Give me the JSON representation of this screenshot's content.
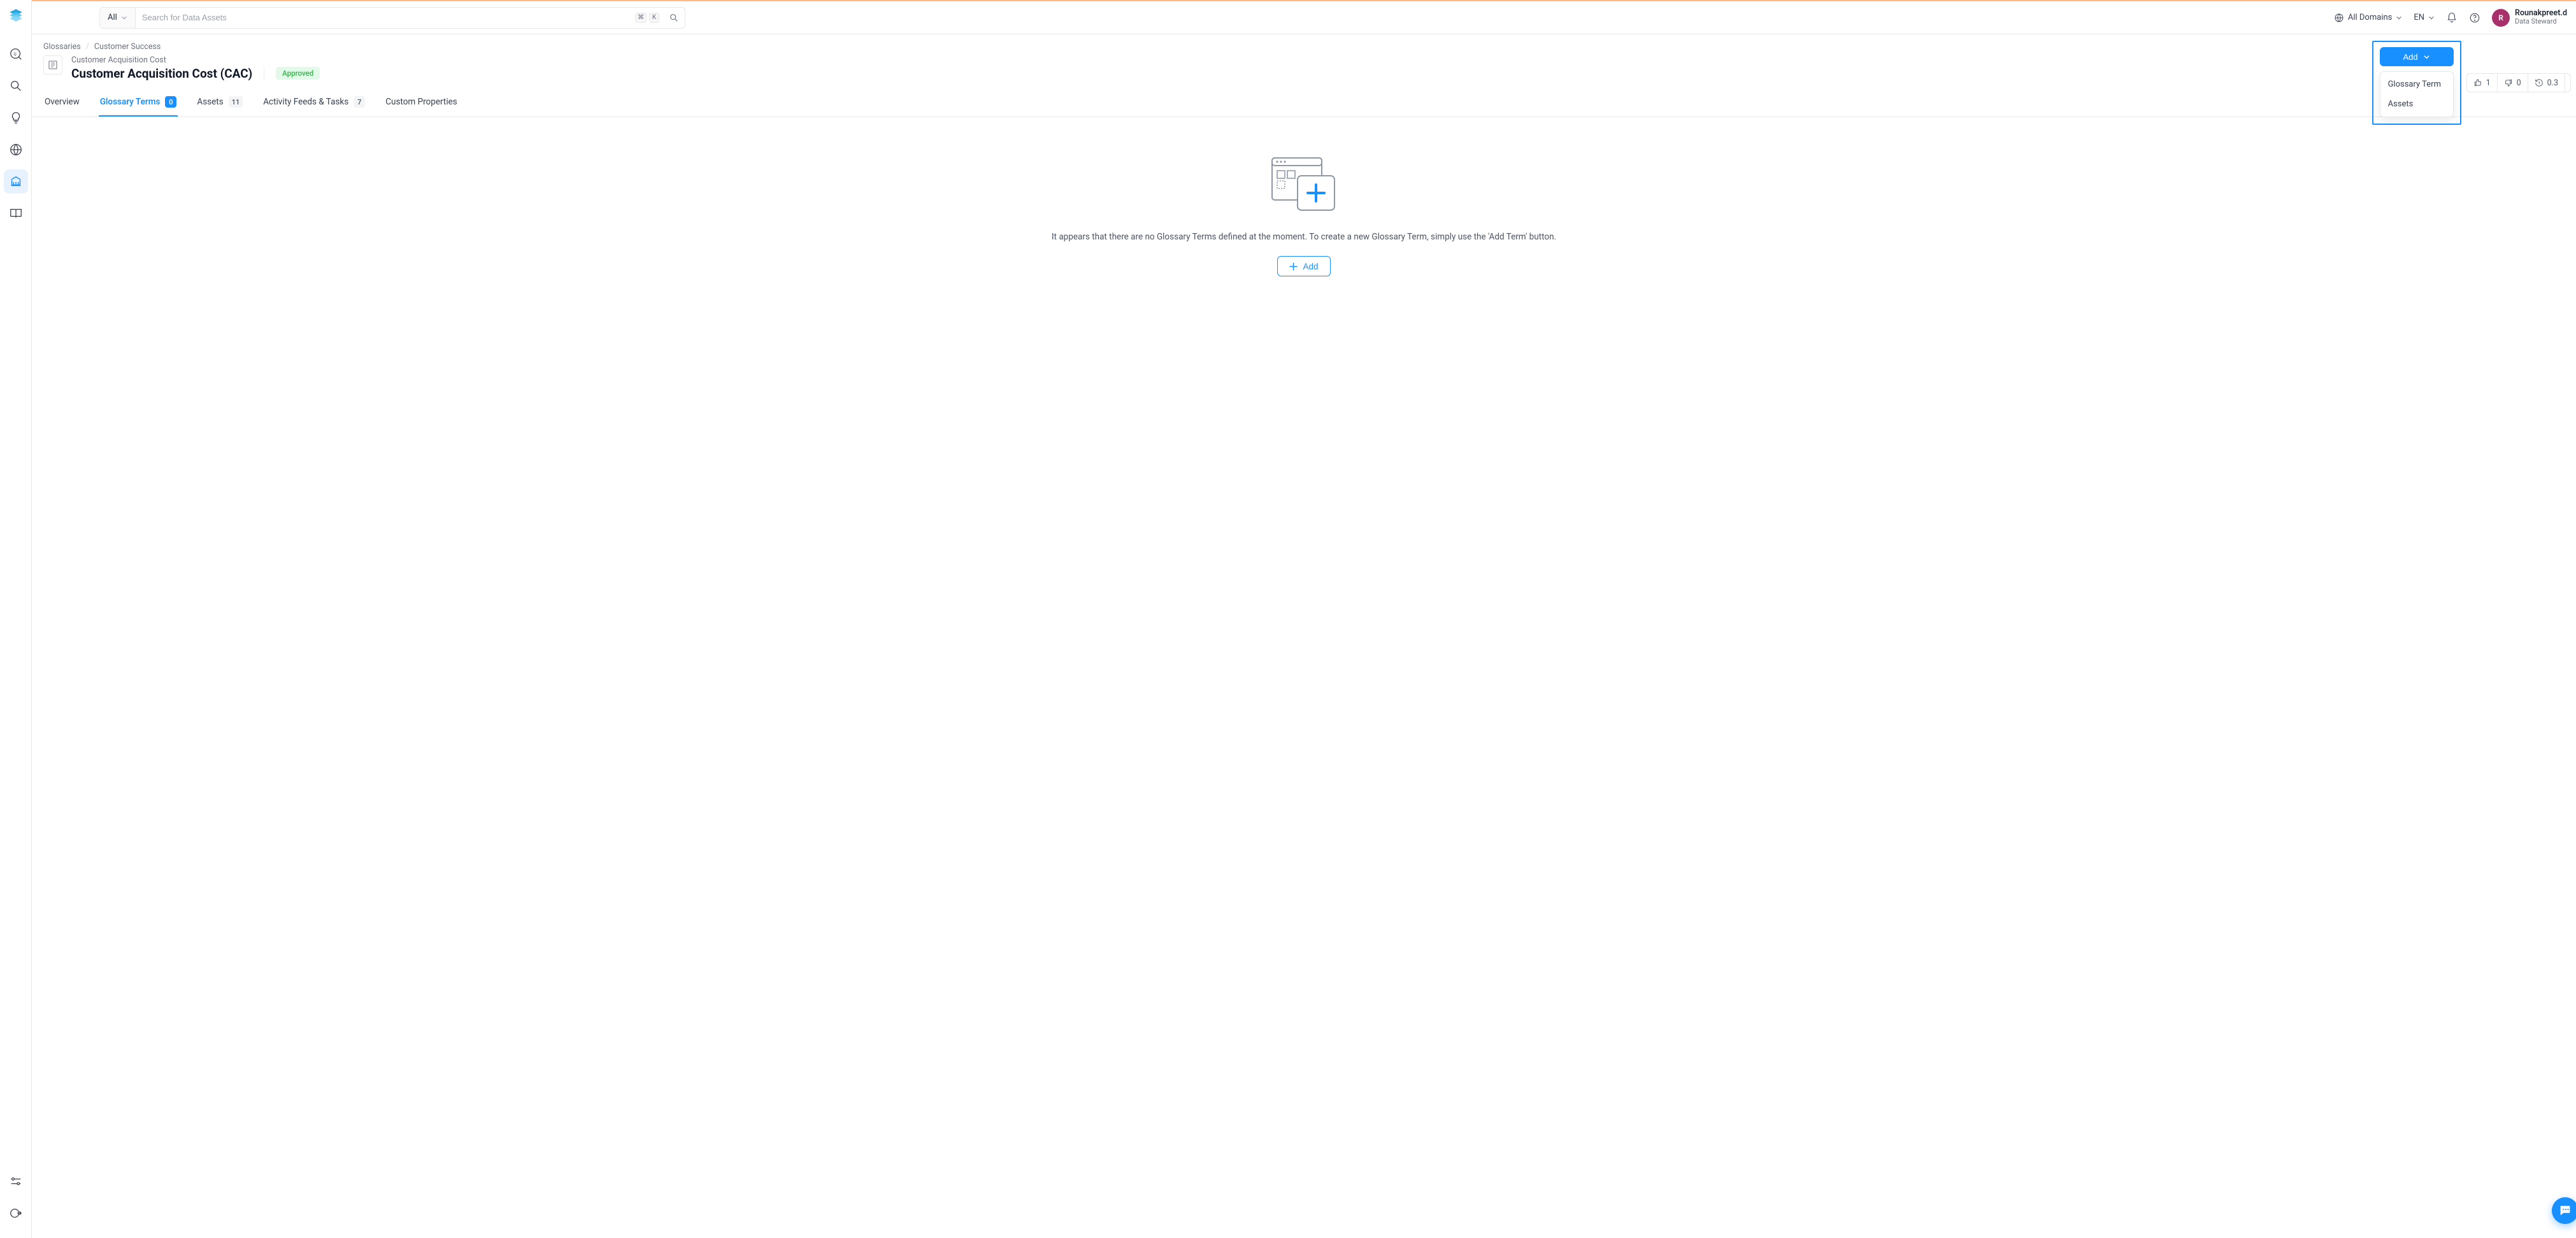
{
  "search": {
    "scope": "All",
    "placeholder": "Search for Data Assets",
    "kbd1": "⌘",
    "kbd2": "K"
  },
  "topbar": {
    "domains_label": "All Domains",
    "lang": "EN"
  },
  "user": {
    "initial": "R",
    "name": "Rounakpreet.d",
    "role": "Data Steward"
  },
  "breadcrumb": {
    "root": "Glossaries",
    "current": "Customer Success"
  },
  "page": {
    "subtitle": "Customer Acquisition Cost",
    "title": "Customer Acquisition Cost (CAC)",
    "status": "Approved"
  },
  "tabs": {
    "overview": "Overview",
    "glossary_terms": "Glossary Terms",
    "glossary_terms_count": "0",
    "assets": "Assets",
    "assets_count": "11",
    "activity": "Activity Feeds & Tasks",
    "activity_count": "7",
    "custom": "Custom Properties"
  },
  "actions": {
    "add": "Add",
    "menu_glossary_term": "Glossary Term",
    "menu_assets": "Assets"
  },
  "stats": {
    "likes": "1",
    "dislikes": "0",
    "version": "0.3"
  },
  "empty": {
    "message": "It appears that there are no Glossary Terms defined at the moment. To create a new Glossary Term, simply use the 'Add Term' button.",
    "add": "Add"
  }
}
